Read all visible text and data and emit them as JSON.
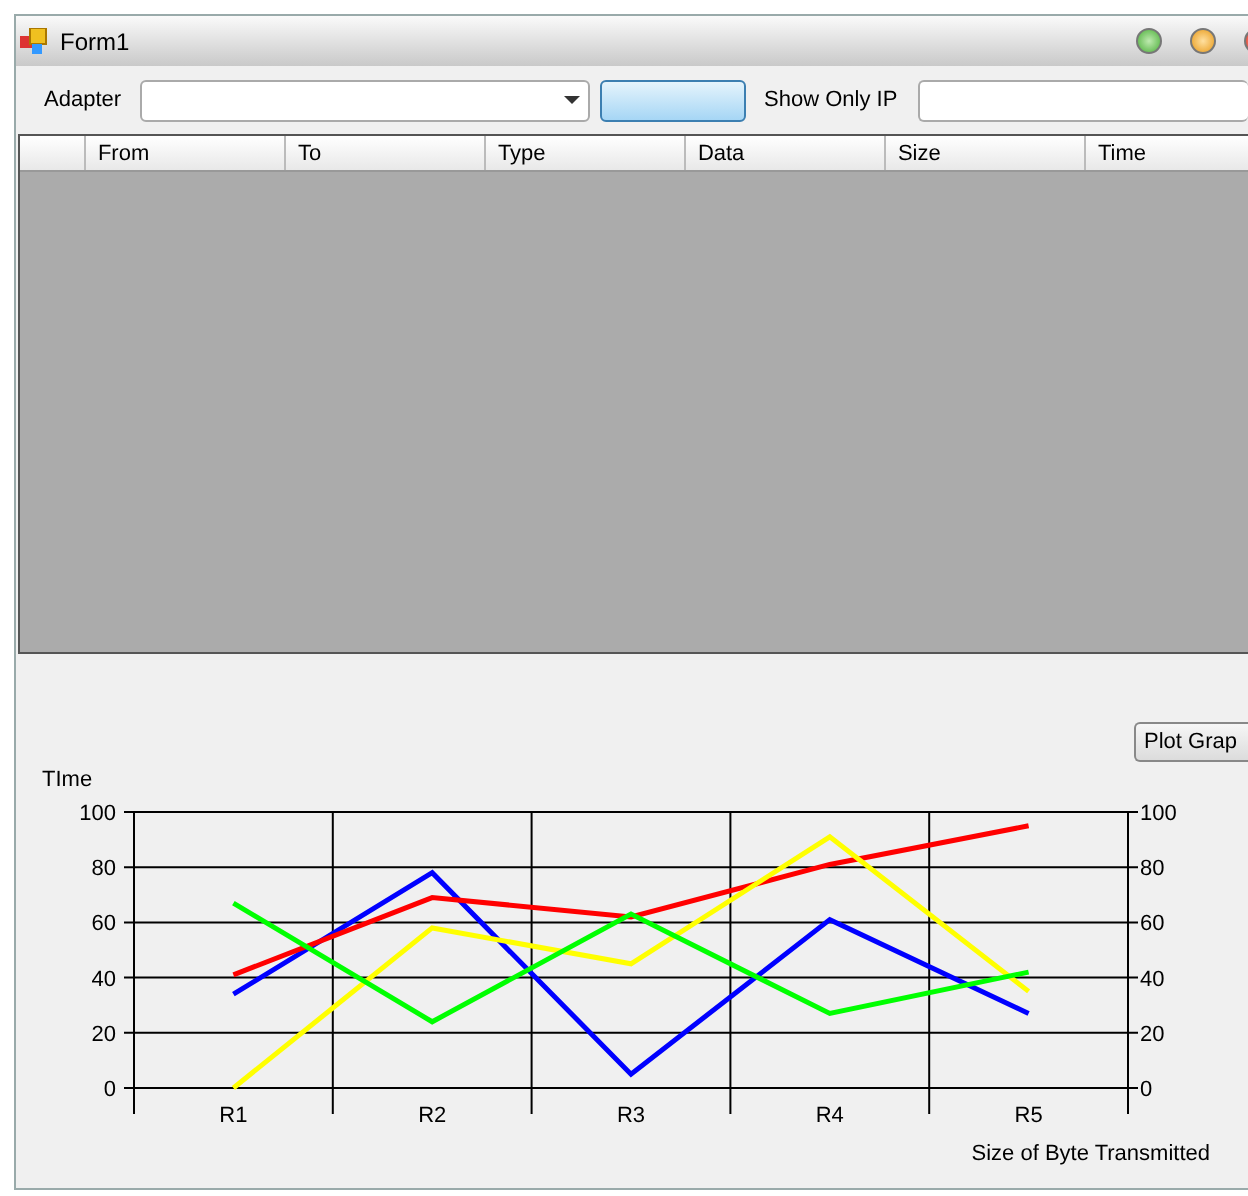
{
  "window": {
    "title": "Form1"
  },
  "toolbar": {
    "adapter_label": "Adapter",
    "show_only_ip_label": "Show Only IP"
  },
  "table": {
    "columns": [
      "From",
      "To",
      "Type",
      "Data",
      "Size",
      "Time"
    ]
  },
  "plot_button": "Plot Grap",
  "chart": {
    "chart_data": {
      "type": "line",
      "xlabel": "Size of Byte Transmitted",
      "ylabel": "TIme",
      "categories": [
        "R1",
        "R2",
        "R3",
        "R4",
        "R5"
      ],
      "ylim": [
        0,
        100
      ],
      "yticks": [
        0,
        20,
        40,
        60,
        80,
        100
      ],
      "grid": true,
      "series": [
        {
          "color": "#0000ff",
          "values": [
            34,
            78,
            5,
            61,
            27
          ]
        },
        {
          "color": "#ff0000",
          "values": [
            41,
            69,
            62,
            81,
            95
          ]
        },
        {
          "color": "#ffff00",
          "values": [
            0,
            58,
            45,
            91,
            35
          ]
        },
        {
          "color": "#00ff00",
          "values": [
            67,
            24,
            63,
            27,
            42
          ]
        }
      ]
    },
    "left_axis_labels": [
      "100",
      "80",
      "60",
      "40",
      "20",
      "0"
    ]
  }
}
